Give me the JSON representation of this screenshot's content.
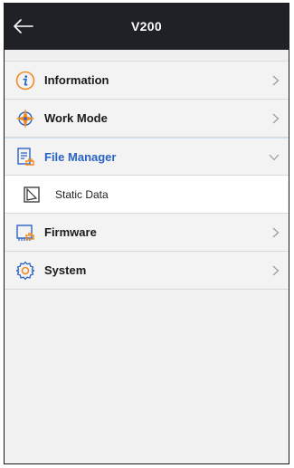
{
  "header": {
    "title": "V200",
    "back_icon": "back-arrow-icon"
  },
  "menu": [
    {
      "label": "Information",
      "icon": "info-icon",
      "chevron": "chevron-right-icon"
    },
    {
      "label": "Work Mode",
      "icon": "compass-icon",
      "chevron": "chevron-right-icon"
    },
    {
      "label": "File Manager",
      "icon": "file-manager-icon",
      "chevron": "chevron-down-icon",
      "expanded": true,
      "children": [
        {
          "label": "Static Data",
          "icon": "static-data-icon"
        }
      ]
    },
    {
      "label": "Firmware",
      "icon": "firmware-icon",
      "chevron": "chevron-right-icon"
    },
    {
      "label": "System",
      "icon": "gear-icon",
      "chevron": "chevron-right-icon"
    }
  ],
  "colors": {
    "header_bg": "#1f2126",
    "accent_orange": "#f08a24",
    "accent_blue": "#2a63c4"
  }
}
